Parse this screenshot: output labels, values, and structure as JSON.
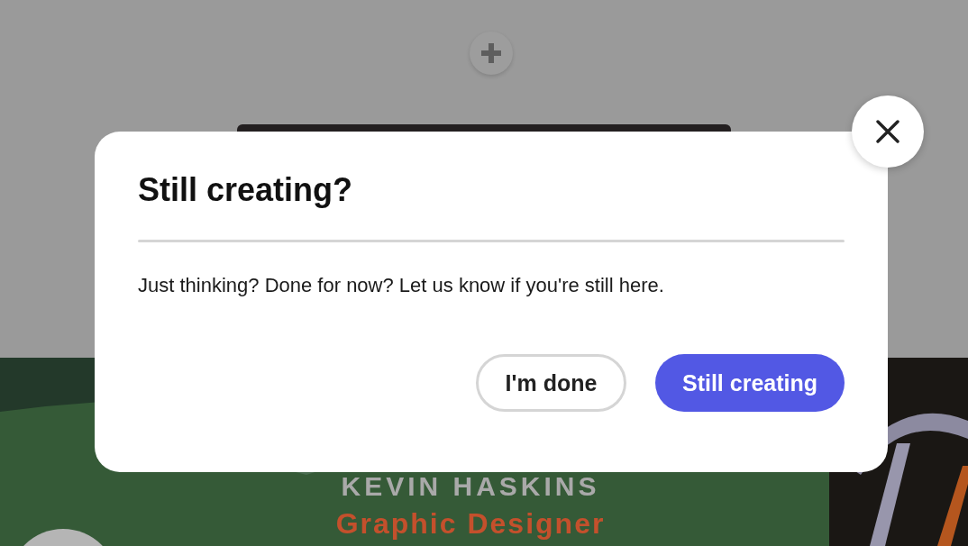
{
  "canvas": {
    "design_texts": [
      {
        "kind": "name",
        "text": "KEVIN HASKINS"
      },
      {
        "kind": "role",
        "text": "Graphic Designer"
      }
    ]
  },
  "dialog": {
    "title": "Still creating?",
    "message": "Just thinking? Done for now? Let us know if you're still here.",
    "buttons": [
      {
        "label": "I'm done",
        "kind": "secondary"
      },
      {
        "label": "Still creating",
        "kind": "primary"
      }
    ]
  }
}
